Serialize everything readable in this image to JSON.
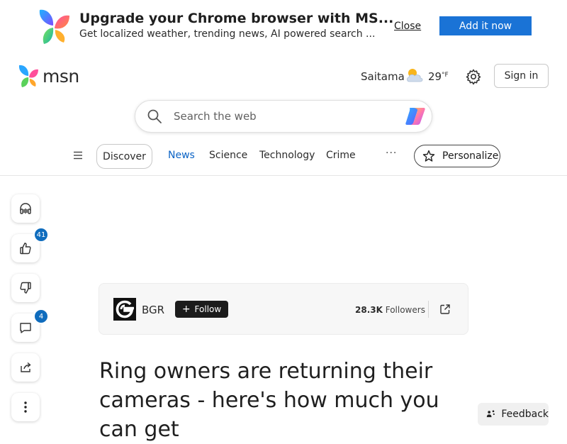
{
  "promo": {
    "title": "Upgrade your Chrome browser with MS...",
    "subtitle": "Get localized weather, trending news, AI powered search ...",
    "close_label": "Close",
    "add_label": "Add it now"
  },
  "header": {
    "logo_text": "msn",
    "location": "Saitama",
    "temperature": "29",
    "temperature_unit": "°F",
    "weather_icon": "partly-cloudy-icon",
    "signin_label": "Sign in"
  },
  "search": {
    "placeholder": "Search the web",
    "value": ""
  },
  "nav": {
    "discover_label": "Discover",
    "items": [
      {
        "label": "News",
        "active": true
      },
      {
        "label": "Science",
        "active": false
      },
      {
        "label": "Technology",
        "active": false
      },
      {
        "label": "Crime",
        "active": false
      }
    ],
    "more_label": "···",
    "personalize_label": "Personalize"
  },
  "rail": {
    "like_count": "41",
    "comment_count": "4"
  },
  "article": {
    "source_name": "BGR",
    "follow_label": "Follow",
    "followers_count": "28.3K",
    "followers_label": "Followers",
    "headline": "Ring owners are returning their cameras - here's how much you can get"
  },
  "feedback_label": "Feedback",
  "colors": {
    "accent": "#1a73d6",
    "nav_active": "#0b63c5",
    "badge": "#0f6cbd"
  }
}
